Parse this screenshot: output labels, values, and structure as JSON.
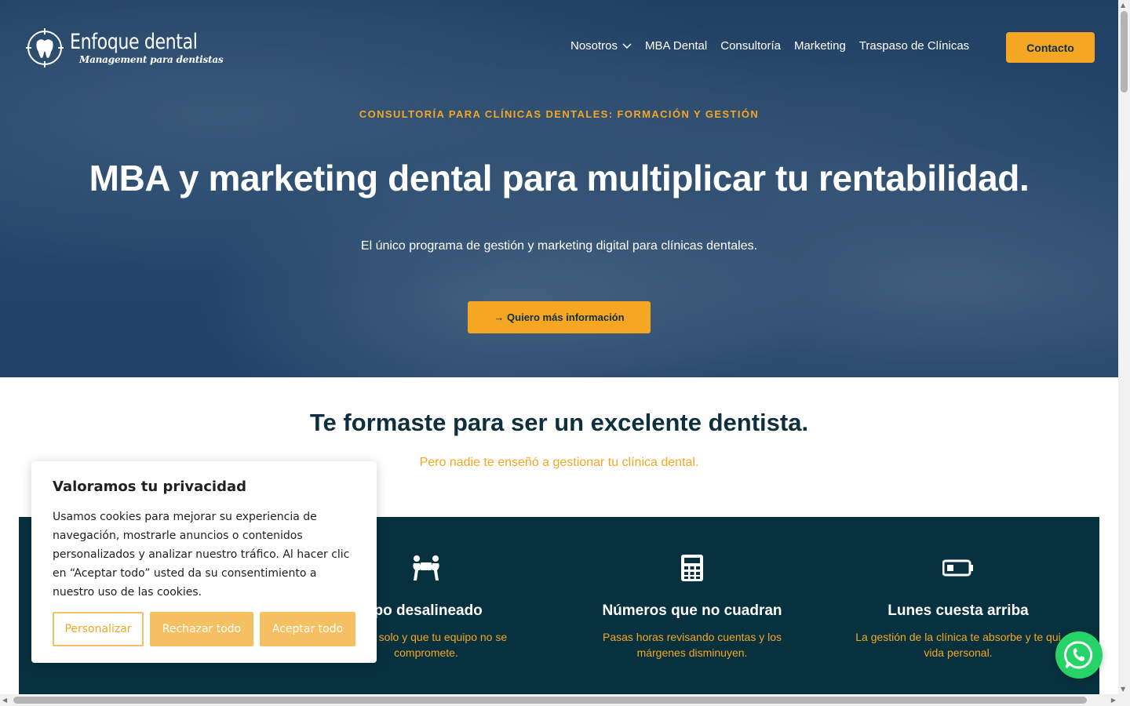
{
  "header": {
    "logo_name": "Enfoque dental",
    "logo_tagline": "Management para dentistas",
    "nav": [
      "Nosotros",
      "MBA Dental",
      "Consultoría",
      "Marketing",
      "Traspaso de Clínicas"
    ],
    "contact_label": "Contacto"
  },
  "hero": {
    "eyebrow": "CONSULTORÍA PARA CLÍNICAS DENTALES: FORMACIÓN Y GESTIÓN",
    "title": "MBA y marketing dental para multiplicar tu rentabilidad.",
    "subtitle": "El único programa de gestión y marketing digital para clínicas dentales.",
    "cta_label": "→ Quiero más información"
  },
  "intro": {
    "title": "Te formaste para ser un excelente dentista.",
    "subtitle": "Pero nadie te enseñó a gestionar tu clínica dental."
  },
  "features": [
    {
      "icon": "people-carry-icon",
      "title": "ipo desalineado",
      "desc": "remas solo y que tu equipo no se compromete."
    },
    {
      "icon": "calculator-icon",
      "title": "Números que no cuadran",
      "desc": "Pasas horas revisando cuentas y los márgenes disminuyen."
    },
    {
      "icon": "battery-low-icon",
      "title": "Lunes cuesta arriba",
      "desc": "La gestión de la clínica te absorbe y te qui vida personal."
    }
  ],
  "cookie": {
    "title": "Valoramos tu privacidad",
    "text": "Usamos cookies para mejorar su experiencia de navegación, mostrarle anuncios o contenidos personalizados y analizar nuestro tráfico. Al hacer clic en “Aceptar todo” usted da su consentimiento a nuestro uso de las cookies.",
    "btn_customize": "Personalizar",
    "btn_reject": "Rechazar todo",
    "btn_accept": "Aceptar todo"
  },
  "colors": {
    "accent": "#f5a623",
    "navy": "#08313f",
    "whatsapp": "#25d366"
  }
}
